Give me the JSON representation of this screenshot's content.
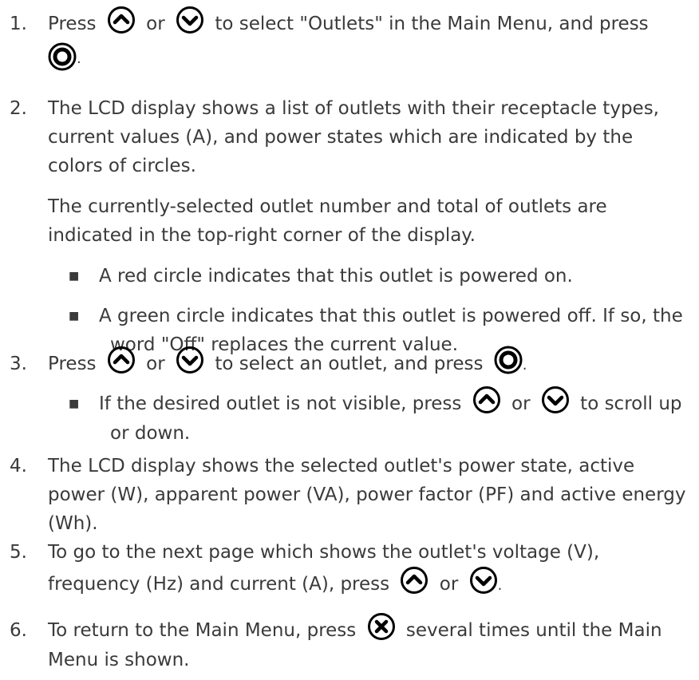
{
  "steps": [
    {
      "num": "1.",
      "a": "Press",
      "or": "or",
      "b": "to select \"Outlets\" in the Main Menu, and press",
      "end": "."
    },
    {
      "num": "2.",
      "line1": "The LCD display shows a list of outlets with their receptacle types,",
      "line2": "current values (A), and power states which are indicated by the",
      "line3": "colors of circles.",
      "para1": "The currently-selected outlet number and total of outlets are",
      "para2": "indicated in the top-right corner of the display.",
      "bullets": [
        {
          "l1": "A red circle indicates that this outlet is powered on."
        },
        {
          "l1": "A green circle indicates that this outlet is powered off. If so, the",
          "l2": "word \"Off\" replaces the current value."
        }
      ]
    },
    {
      "num": "3.",
      "a": "Press",
      "or": "or",
      "b": "to select an outlet, and press",
      "end": ".",
      "bullet": {
        "a": "If the desired outlet is not visible, press",
        "or": "or",
        "b": "to scroll up",
        "l2": "or down."
      }
    },
    {
      "num": "4.",
      "line1": "The LCD display shows the selected outlet's power state, active",
      "line2": "power (W), apparent power (VA), power factor (PF) and active energy",
      "line3": "(Wh)."
    },
    {
      "num": "5.",
      "line1": "To go to the next page which shows the outlet's voltage (V),",
      "line2": "frequency (Hz) and current (A), press",
      "or": "or",
      "end": "."
    },
    {
      "num": "6.",
      "line1": "To return to the Main Menu, press",
      "line1b": "several times until the Main",
      "line2": "Menu is shown."
    }
  ],
  "icons": {
    "up": "up-arrow-button-icon",
    "down": "down-arrow-button-icon",
    "ok": "ok-circle-button-icon",
    "cancel": "x-cancel-button-icon"
  }
}
